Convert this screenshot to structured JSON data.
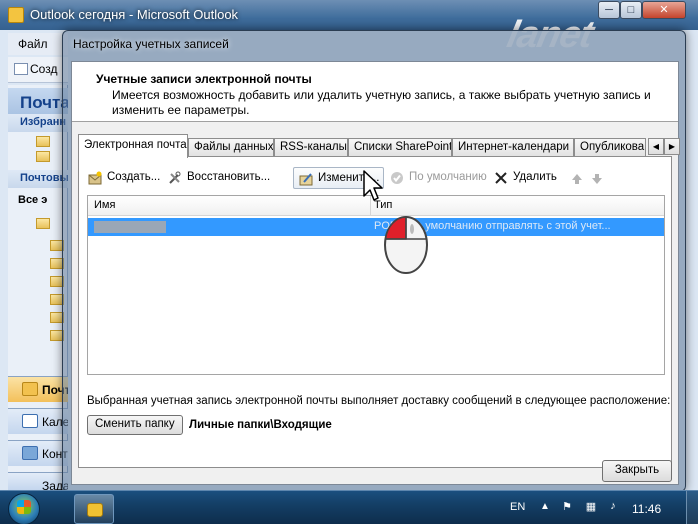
{
  "window": {
    "title": "Outlook сегодня - Microsoft Outlook",
    "brand": "lanet",
    "minimize": "─",
    "maximize": "□",
    "close": "✕"
  },
  "outlook": {
    "menu_file": "Файл",
    "toolbar_create": "Созд",
    "nav_header": "Почта",
    "favorites": "Избранн",
    "mail_folders": "Почтовые",
    "all_items": "Все э",
    "nav_buttons": [
      "Почта",
      "Календарь",
      "Контакты",
      "Задачи"
    ]
  },
  "dialog": {
    "title": "Настройка учетных записей",
    "heading": "Учетные записи электронной почты",
    "description": "Имеется возможность добавить или удалить учетную запись, а также выбрать учетную запись и изменить ее параметры.",
    "tabs": [
      "Электронная почта",
      "Файлы данных",
      "RSS-каналы",
      "Списки SharePoint",
      "Интернет-календари",
      "Опубликова"
    ],
    "active_tab": "Электронная почта",
    "toolbar": {
      "create": "Создать...",
      "repair": "Восстановить...",
      "change": "Изменить...",
      "default": "По умолчанию",
      "delete": "Удалить"
    },
    "grid": {
      "col_name": "Имя",
      "col_type": "Тип",
      "row_type": "POP3 (по умолчанию отправлять с этой учет..."
    },
    "deliver_text": "Выбранная учетная запись электронной почты выполняет доставку сообщений в следующее расположение:",
    "change_folder": "Сменить папку",
    "folder_path": "Личные папки\\Входящие",
    "close": "Закрыть"
  },
  "taskbar": {
    "language": "EN",
    "tray_arrow": "▲",
    "time": "11:46"
  },
  "icons": {
    "start": "windows-start-icon",
    "outlook": "outlook-icon",
    "cursor": "mouse-pointer-icon",
    "mouse": "mouse-click-icon"
  },
  "colors": {
    "selection": "#3399ff",
    "taskbar": "#143f66",
    "mouse_button": "#e0202a"
  }
}
